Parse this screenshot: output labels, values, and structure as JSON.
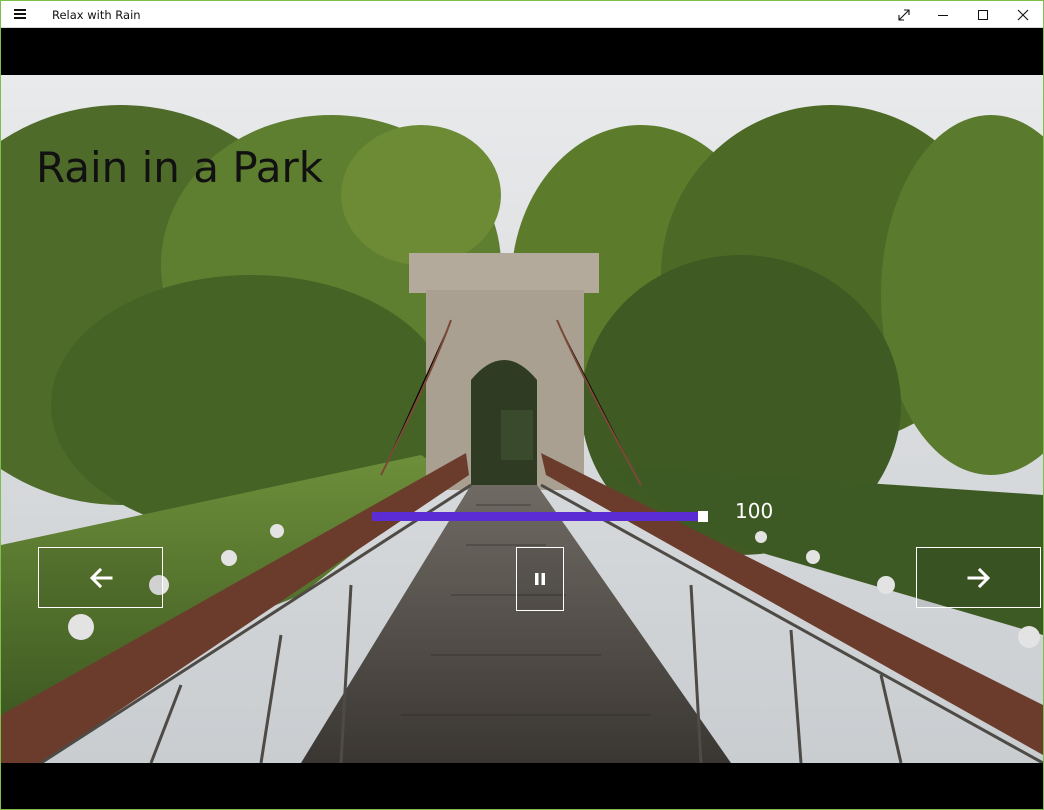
{
  "window": {
    "title": "Relax with Rain",
    "controls": [
      "expand-icon",
      "minimize-icon",
      "maximize-icon",
      "close-icon"
    ]
  },
  "scene": {
    "title": "Rain in a Park",
    "image": "suspension-bridge-in-park"
  },
  "volume": {
    "value": "100",
    "level": 1.0
  },
  "buttons": {
    "previous_icon": "arrow-left-icon",
    "pause_icon": "pause-icon",
    "next_icon": "arrow-right-icon"
  },
  "colors": {
    "accent": "#5b2bd3",
    "window_border": "#7cc04b",
    "title_text": "#111111"
  }
}
